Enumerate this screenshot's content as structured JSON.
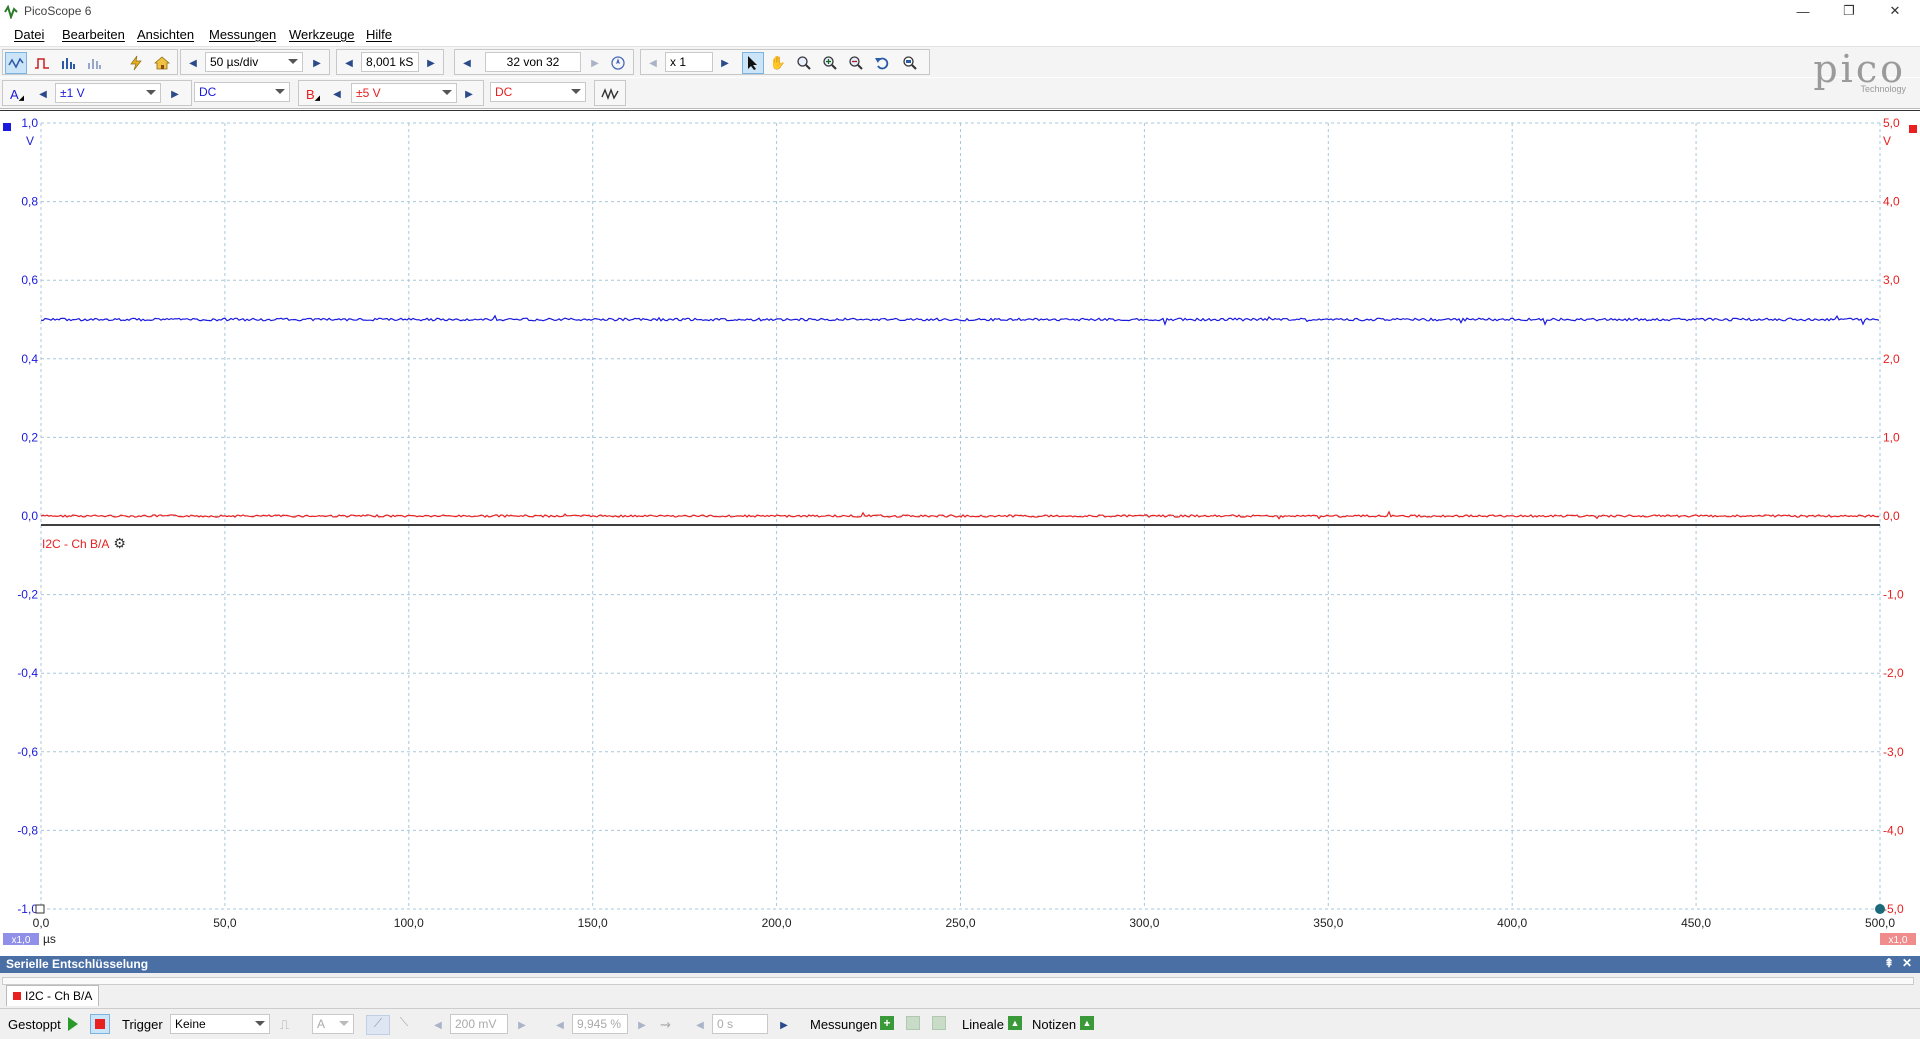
{
  "window": {
    "title": "PicoScope 6",
    "minimize": "—",
    "restore": "❐",
    "close": "✕"
  },
  "menu": [
    "Datei",
    "Bearbeiten",
    "Ansichten",
    "Messungen",
    "Werkzeuge",
    "Hilfe"
  ],
  "toolbar": {
    "timebase": "50 µs/div",
    "samples": "8,001 kS",
    "buffer": "32 von 32",
    "zoom": "x 1"
  },
  "channels": {
    "a": {
      "label": "A",
      "range": "±1 V",
      "coupling": "DC",
      "color": "#1a1adc"
    },
    "b": {
      "label": "B",
      "range": "±5 V",
      "coupling": "DC",
      "color": "#e82020"
    }
  },
  "logo": {
    "main": "pico",
    "sub": "Technology"
  },
  "plot": {
    "left_unit": "V",
    "right_unit": "V",
    "x_unit": "µs",
    "left_ticks": [
      "1,0",
      "0,8",
      "0,6",
      "0,4",
      "0,2",
      "0,0",
      "-0,2",
      "-0,4",
      "-0,6",
      "-0,8",
      "-1,0"
    ],
    "right_ticks": [
      "5,0",
      "4,0",
      "3,0",
      "2,0",
      "1,0",
      "0,0",
      "-1,0",
      "-2,0",
      "-3,0",
      "-4,0",
      "-5,0"
    ],
    "x_ticks": [
      "0,0",
      "50,0",
      "100,0",
      "150,0",
      "200,0",
      "250,0",
      "300,0",
      "350,0",
      "400,0",
      "450,0",
      "500,0"
    ],
    "left_scale": "x1,0",
    "right_scale": "x1,0",
    "decode_label": "I2C - Ch B/A",
    "channel_a_level_v": 0.5,
    "channel_b_level_v": 0.0
  },
  "chart_data": {
    "type": "line",
    "x_range": [
      0,
      500
    ],
    "y_range_a": [
      -1.0,
      1.0
    ],
    "y_range_b": [
      -5.0,
      5.0
    ],
    "grid": true,
    "series": [
      {
        "name": "A",
        "values": [
          0.5,
          0.5
        ]
      },
      {
        "name": "B",
        "values": [
          0.0,
          0.0
        ]
      }
    ]
  },
  "serial_panel": {
    "title": "Serielle Entschlüsselung",
    "tab": "I2C - Ch B/A"
  },
  "statusbar": {
    "state": "Gestoppt",
    "trigger_label": "Trigger",
    "trigger_mode": "Keine",
    "trigger_channel": "A",
    "threshold": "200 mV",
    "pretrigger": "9,945 %",
    "delay": "0 s",
    "measurements": "Messungen",
    "rulers": "Lineale",
    "notes": "Notizen"
  }
}
